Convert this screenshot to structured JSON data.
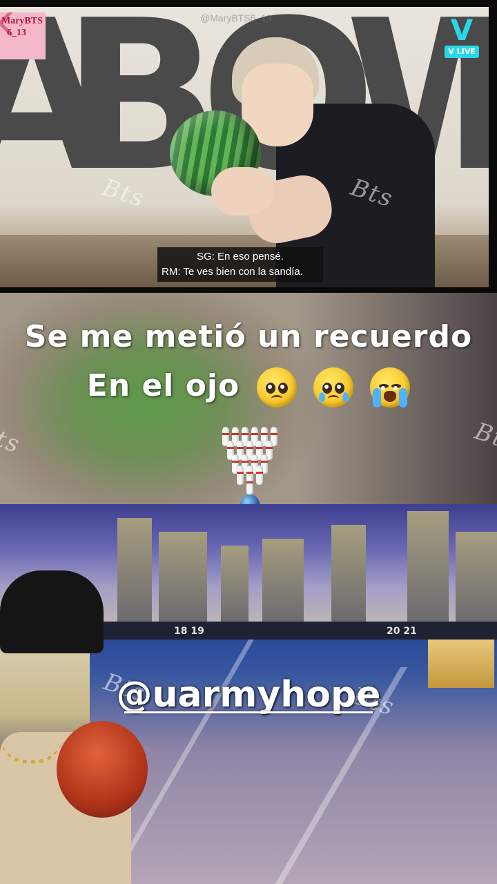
{
  "top_video": {
    "corner_tag": {
      "line1": "MaryBTS",
      "line2": "6_13"
    },
    "faded_handle": "@MaryBTS6_13",
    "wall_text": "ABOWL",
    "vlive_logo": {
      "mark": "V",
      "label": "V LIVE"
    },
    "subtitles": {
      "line1": "SG: En eso pensé.",
      "line2": "RM: Te ves bien con la sandía."
    },
    "watermarks": [
      "Bts",
      "Bts"
    ]
  },
  "caption": {
    "line1": "Se me metió un recuerdo",
    "line2": "En el ojo",
    "emojis": [
      "pleading-face",
      "holding-back-tears-face",
      "loudly-crying-face"
    ],
    "decoration": [
      "bowling-pins-icon",
      "bowling-ball-icon"
    ],
    "watermarks": [
      "ts",
      "Bt"
    ]
  },
  "bottom_video": {
    "scoreboard": {
      "left": "18 19",
      "right": "20 21"
    },
    "handle": "@uarmyhope",
    "watermarks": [
      "Bts",
      "Bts"
    ]
  },
  "colors": {
    "vlive_cyan": "#28d7e8",
    "tag_pink": "#f4b9c8",
    "tag_text": "#b2163e",
    "caption_text": "#ffffff"
  }
}
